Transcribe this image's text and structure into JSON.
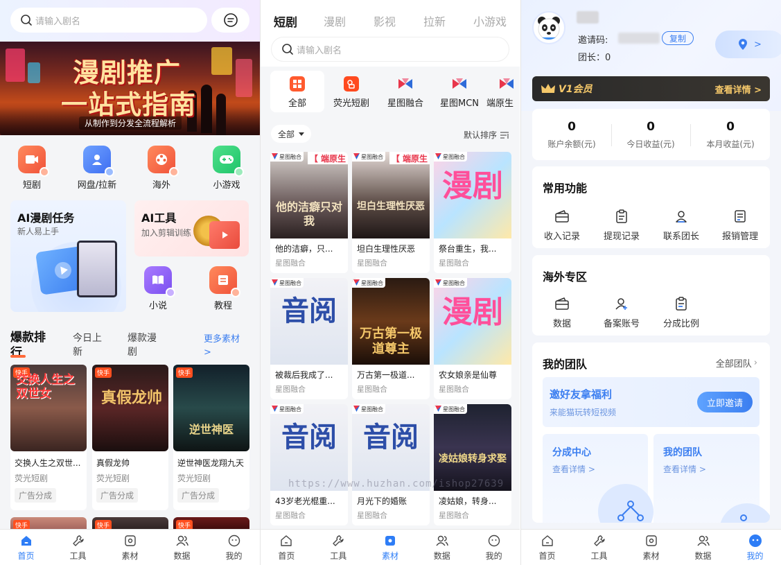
{
  "home": {
    "search_placeholder": "请输入剧名",
    "banner": {
      "line1": "漫剧推广",
      "line2": "一站式指南",
      "line3": "从制作到分发全流程解析"
    },
    "quick": [
      {
        "label": "短剧"
      },
      {
        "label": "网盘/拉新"
      },
      {
        "label": "海外"
      },
      {
        "label": "小游戏"
      }
    ],
    "ai_task": {
      "title": "AI漫剧任务",
      "subtitle": "新人易上手"
    },
    "ai_tool": {
      "title": "AI工具",
      "subtitle": "加入剪辑训练"
    },
    "mini": [
      {
        "label": "小说"
      },
      {
        "label": "教程"
      }
    ],
    "section_tabs": {
      "t1": "爆款排行",
      "t2": "今日上新",
      "t3": "爆款漫剧",
      "more": "更多素材 >"
    },
    "badge": "快手",
    "posters": [
      {
        "title": "交换人生之双世...",
        "source": "荧光短剧",
        "tag": "广告分成",
        "art": "交换人生之双世女"
      },
      {
        "title": "真假龙帅",
        "source": "荧光短剧",
        "tag": "广告分成",
        "art": "真假龙帅"
      },
      {
        "title": "逆世神医龙翔九天",
        "source": "荧光短剧",
        "tag": "广告分成",
        "art": "逆世神医"
      }
    ]
  },
  "materials": {
    "tabs": [
      "短剧",
      "漫剧",
      "影视",
      "拉新",
      "小游戏"
    ],
    "search_placeholder": "请输入剧名",
    "cats": [
      "全部",
      "荧光短剧",
      "星图融合",
      "星图MCN",
      "端原生"
    ],
    "filter": "全部",
    "sort": "默认排序",
    "tag": "星图融合",
    "items": [
      {
        "title": "他的洁癖，只...",
        "source": "星图融合",
        "art": "他的洁癖只对我",
        "banner": "【 端原生"
      },
      {
        "title": "坦白生理性厌恶",
        "source": "星图融合",
        "art": "坦白生理性厌恶",
        "banner": "【 端原生"
      },
      {
        "title": "祭台重生，我...",
        "source": "星图融合",
        "art": "漫剧"
      },
      {
        "title": "被裁后我成了...",
        "source": "星图融合",
        "art": "音阅"
      },
      {
        "title": "万古第一极道...",
        "source": "星图融合",
        "art": "万古第一极道尊主"
      },
      {
        "title": "农女娘亲是仙尊",
        "source": "星图融合",
        "art": "漫剧"
      },
      {
        "title": "43岁老光棍重...",
        "source": "星图融合",
        "art": "音阅"
      },
      {
        "title": "月光下的婚账",
        "source": "星图融合",
        "art": "音阅"
      },
      {
        "title": "凌姑娘，转身...",
        "source": "星图融合",
        "art": "凌姑娘转身求娶"
      }
    ],
    "watermark": "https://www.huzhan.com/ishop27639"
  },
  "profile": {
    "invite_label": "邀请码:",
    "copy_label": "复制",
    "leader_label": "团长：0",
    "location_arrow": ">",
    "vip_label": "V1会员",
    "vip_more": "查看详情 >",
    "stats": [
      {
        "value": "0",
        "label": "账户余额(元)"
      },
      {
        "value": "0",
        "label": "今日收益(元)"
      },
      {
        "value": "0",
        "label": "本月收益(元)"
      }
    ],
    "common_title": "常用功能",
    "common": [
      "收入记录",
      "提现记录",
      "联系团长",
      "报销管理"
    ],
    "overseas_title": "海外专区",
    "overseas": [
      "数据",
      "备案账号",
      "分成比例"
    ],
    "team_title": "我的团队",
    "team_all": "全部团队",
    "invite_title": "邀好友拿福利",
    "invite_sub": "来能猫玩转短视频",
    "invite_btn": "立即邀请",
    "share_title": "分成中心",
    "share_more": "查看详情 >",
    "myteam_title": "我的团队",
    "myteam_more": "查看详情 >"
  },
  "tabbar": [
    "首页",
    "工具",
    "素材",
    "数据",
    "我的"
  ]
}
